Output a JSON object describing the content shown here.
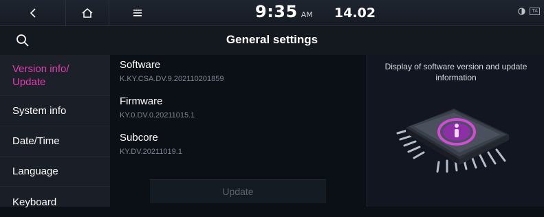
{
  "status_bar": {
    "time": "9:35",
    "ampm": "AM",
    "date": "14.02",
    "badge": "TA"
  },
  "header": {
    "title": "General settings"
  },
  "sidebar": {
    "items": [
      {
        "label": "Version info/\nUpdate",
        "active": true
      },
      {
        "label": "System info"
      },
      {
        "label": "Date/Time"
      },
      {
        "label": "Language"
      },
      {
        "label": "Keyboard"
      }
    ]
  },
  "main": {
    "software": {
      "title": "Software",
      "value": "K.KY.CSA.DV.9.202110201859"
    },
    "firmware": {
      "title": "Firmware",
      "value": "KY.0.DV.0.20211015.1"
    },
    "subcore": {
      "title": "Subcore",
      "value": "KY.DV.20211019.1"
    },
    "update_label": "Update"
  },
  "description": {
    "text": "Display of software version and update information"
  },
  "colors": {
    "accent": "#e23fae",
    "background": "#0b0f16"
  },
  "icons": [
    "back-icon",
    "home-icon",
    "menu-icon",
    "search-icon",
    "moon-icon",
    "chip-info-icon"
  ]
}
